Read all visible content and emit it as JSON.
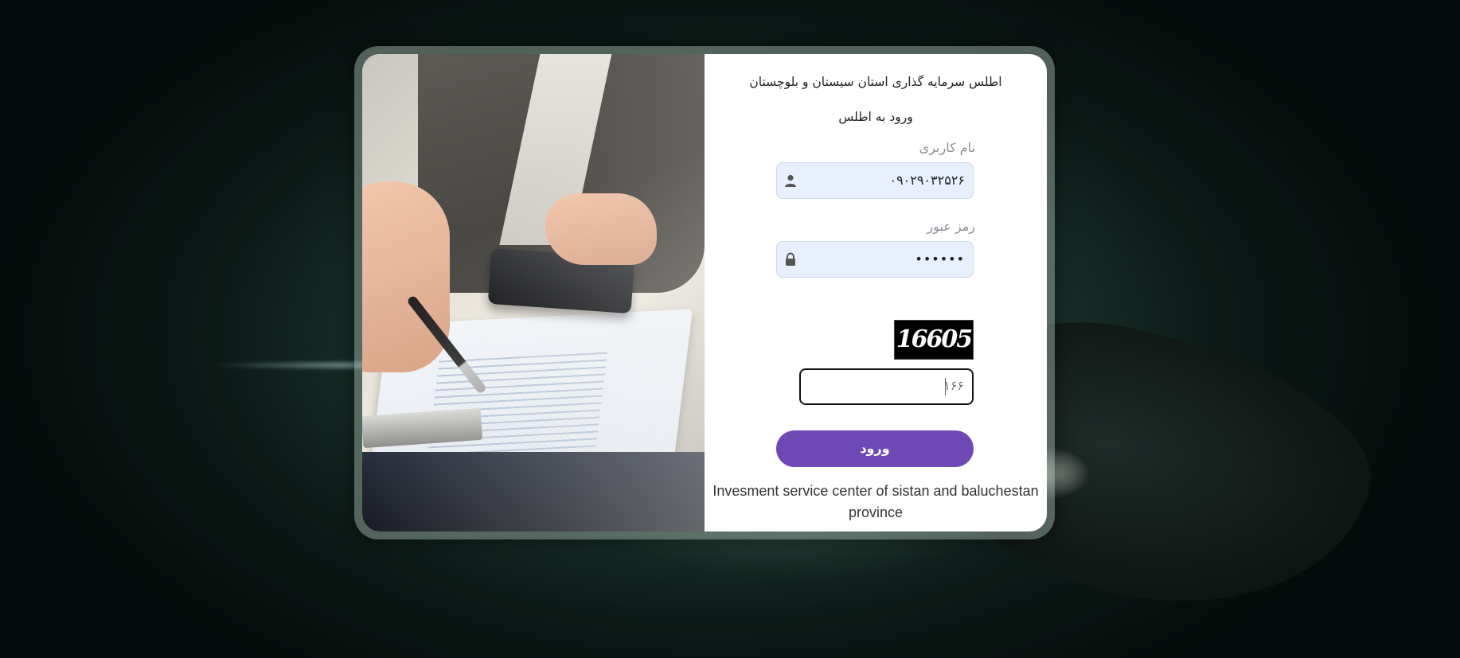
{
  "header": {
    "title": "اطلس سرمایه گذاری استان سیستان و بلوچستان",
    "subtitle": "ورود به اطلس"
  },
  "form": {
    "username": {
      "label": "نام کاربری",
      "value": "۰۹۰۲۹۰۳۲۵۲۶",
      "icon": "user-icon"
    },
    "password": {
      "label": "رمز عبور",
      "value": "••••••",
      "icon": "lock-icon"
    },
    "captcha": {
      "image_text": "16605",
      "input_value": "۱۶۶"
    },
    "login_label": "ورود"
  },
  "footer": {
    "text": "Invesment service center of sistan and baluchestan province"
  },
  "colors": {
    "accent": "#7048b5",
    "field_bg": "#e8effd",
    "label": "#8a8f96"
  }
}
